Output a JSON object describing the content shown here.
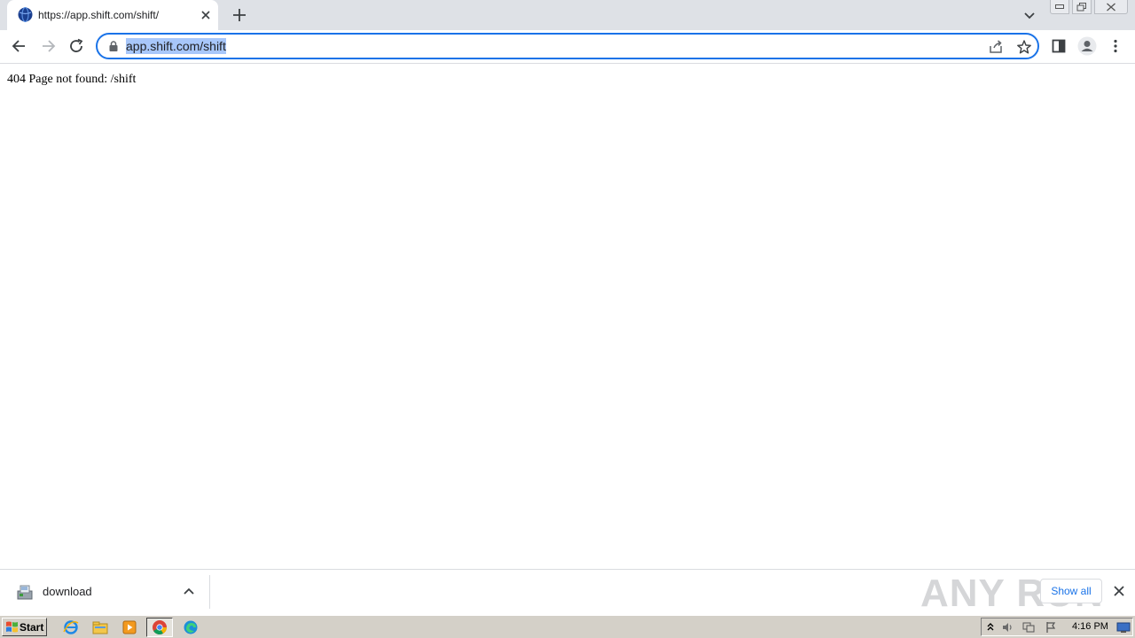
{
  "tab": {
    "title": "https://app.shift.com/shift/"
  },
  "omnibox": {
    "url": "app.shift.com/shift"
  },
  "page": {
    "message": "404 Page not found: /shift"
  },
  "download_shelf": {
    "file_name": "download",
    "show_all_label": "Show all",
    "watermark": "ANY RUN"
  },
  "taskbar": {
    "start_label": "Start",
    "clock": "4:16 PM"
  },
  "colors": {
    "accent": "#1a73e8",
    "selection": "#a8c7fa",
    "tabstrip": "#dee1e6",
    "taskbar": "#d4d0c8"
  }
}
